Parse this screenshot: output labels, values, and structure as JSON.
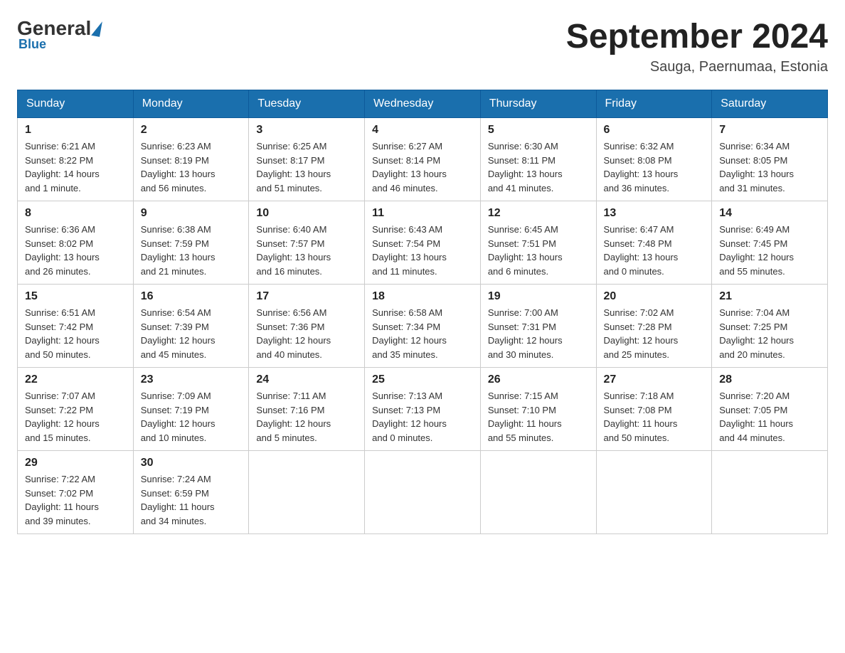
{
  "header": {
    "logo_general": "General",
    "logo_blue": "Blue",
    "month_year": "September 2024",
    "location": "Sauga, Paernumaa, Estonia"
  },
  "days_of_week": [
    "Sunday",
    "Monday",
    "Tuesday",
    "Wednesday",
    "Thursday",
    "Friday",
    "Saturday"
  ],
  "weeks": [
    [
      {
        "num": "1",
        "info": "Sunrise: 6:21 AM\nSunset: 8:22 PM\nDaylight: 14 hours\nand 1 minute."
      },
      {
        "num": "2",
        "info": "Sunrise: 6:23 AM\nSunset: 8:19 PM\nDaylight: 13 hours\nand 56 minutes."
      },
      {
        "num": "3",
        "info": "Sunrise: 6:25 AM\nSunset: 8:17 PM\nDaylight: 13 hours\nand 51 minutes."
      },
      {
        "num": "4",
        "info": "Sunrise: 6:27 AM\nSunset: 8:14 PM\nDaylight: 13 hours\nand 46 minutes."
      },
      {
        "num": "5",
        "info": "Sunrise: 6:30 AM\nSunset: 8:11 PM\nDaylight: 13 hours\nand 41 minutes."
      },
      {
        "num": "6",
        "info": "Sunrise: 6:32 AM\nSunset: 8:08 PM\nDaylight: 13 hours\nand 36 minutes."
      },
      {
        "num": "7",
        "info": "Sunrise: 6:34 AM\nSunset: 8:05 PM\nDaylight: 13 hours\nand 31 minutes."
      }
    ],
    [
      {
        "num": "8",
        "info": "Sunrise: 6:36 AM\nSunset: 8:02 PM\nDaylight: 13 hours\nand 26 minutes."
      },
      {
        "num": "9",
        "info": "Sunrise: 6:38 AM\nSunset: 7:59 PM\nDaylight: 13 hours\nand 21 minutes."
      },
      {
        "num": "10",
        "info": "Sunrise: 6:40 AM\nSunset: 7:57 PM\nDaylight: 13 hours\nand 16 minutes."
      },
      {
        "num": "11",
        "info": "Sunrise: 6:43 AM\nSunset: 7:54 PM\nDaylight: 13 hours\nand 11 minutes."
      },
      {
        "num": "12",
        "info": "Sunrise: 6:45 AM\nSunset: 7:51 PM\nDaylight: 13 hours\nand 6 minutes."
      },
      {
        "num": "13",
        "info": "Sunrise: 6:47 AM\nSunset: 7:48 PM\nDaylight: 13 hours\nand 0 minutes."
      },
      {
        "num": "14",
        "info": "Sunrise: 6:49 AM\nSunset: 7:45 PM\nDaylight: 12 hours\nand 55 minutes."
      }
    ],
    [
      {
        "num": "15",
        "info": "Sunrise: 6:51 AM\nSunset: 7:42 PM\nDaylight: 12 hours\nand 50 minutes."
      },
      {
        "num": "16",
        "info": "Sunrise: 6:54 AM\nSunset: 7:39 PM\nDaylight: 12 hours\nand 45 minutes."
      },
      {
        "num": "17",
        "info": "Sunrise: 6:56 AM\nSunset: 7:36 PM\nDaylight: 12 hours\nand 40 minutes."
      },
      {
        "num": "18",
        "info": "Sunrise: 6:58 AM\nSunset: 7:34 PM\nDaylight: 12 hours\nand 35 minutes."
      },
      {
        "num": "19",
        "info": "Sunrise: 7:00 AM\nSunset: 7:31 PM\nDaylight: 12 hours\nand 30 minutes."
      },
      {
        "num": "20",
        "info": "Sunrise: 7:02 AM\nSunset: 7:28 PM\nDaylight: 12 hours\nand 25 minutes."
      },
      {
        "num": "21",
        "info": "Sunrise: 7:04 AM\nSunset: 7:25 PM\nDaylight: 12 hours\nand 20 minutes."
      }
    ],
    [
      {
        "num": "22",
        "info": "Sunrise: 7:07 AM\nSunset: 7:22 PM\nDaylight: 12 hours\nand 15 minutes."
      },
      {
        "num": "23",
        "info": "Sunrise: 7:09 AM\nSunset: 7:19 PM\nDaylight: 12 hours\nand 10 minutes."
      },
      {
        "num": "24",
        "info": "Sunrise: 7:11 AM\nSunset: 7:16 PM\nDaylight: 12 hours\nand 5 minutes."
      },
      {
        "num": "25",
        "info": "Sunrise: 7:13 AM\nSunset: 7:13 PM\nDaylight: 12 hours\nand 0 minutes."
      },
      {
        "num": "26",
        "info": "Sunrise: 7:15 AM\nSunset: 7:10 PM\nDaylight: 11 hours\nand 55 minutes."
      },
      {
        "num": "27",
        "info": "Sunrise: 7:18 AM\nSunset: 7:08 PM\nDaylight: 11 hours\nand 50 minutes."
      },
      {
        "num": "28",
        "info": "Sunrise: 7:20 AM\nSunset: 7:05 PM\nDaylight: 11 hours\nand 44 minutes."
      }
    ],
    [
      {
        "num": "29",
        "info": "Sunrise: 7:22 AM\nSunset: 7:02 PM\nDaylight: 11 hours\nand 39 minutes."
      },
      {
        "num": "30",
        "info": "Sunrise: 7:24 AM\nSunset: 6:59 PM\nDaylight: 11 hours\nand 34 minutes."
      },
      null,
      null,
      null,
      null,
      null
    ]
  ]
}
